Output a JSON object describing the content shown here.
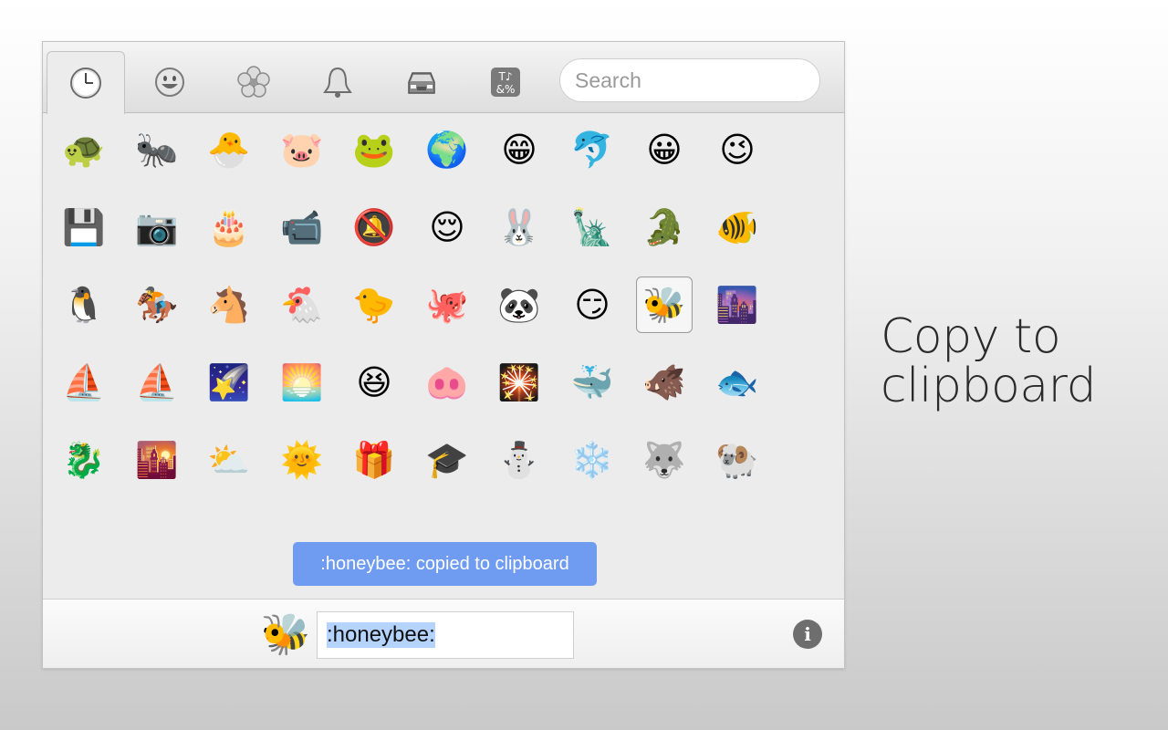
{
  "tabs": [
    {
      "name": "recent",
      "icon": "clock-icon"
    },
    {
      "name": "people",
      "icon": "smiley-icon"
    },
    {
      "name": "nature",
      "icon": "flower-icon"
    },
    {
      "name": "objects",
      "icon": "bell-icon"
    },
    {
      "name": "places",
      "icon": "car-icon"
    },
    {
      "name": "symbols",
      "icon": "symbols-icon",
      "glyph_top": "T♪",
      "glyph_bottom": "&%"
    }
  ],
  "active_tab": "recent",
  "search": {
    "placeholder": "Search",
    "value": ""
  },
  "emoji_grid": [
    [
      "🐢",
      "🐜",
      "🐣",
      "🐷",
      "🐸",
      "🌍",
      "😁",
      "🐬",
      "😀",
      "😉"
    ],
    [
      "💾",
      "📷",
      "🎂",
      "📹",
      "🔕",
      "😌",
      "🐰",
      "🗽",
      "🐊",
      "🐠"
    ],
    [
      "🐧",
      "🏇",
      "🐴",
      "🐔",
      "🐤",
      "🐙",
      "🐼",
      "😏",
      "🐝",
      "🌆"
    ],
    [
      "⛵",
      "⛵",
      "🌠",
      "🌅",
      "😆",
      "🐽",
      "🎇",
      "🐳",
      "🐗",
      "🐟"
    ],
    [
      "🐉",
      "🌇",
      "⛅",
      "🌞",
      "🎁",
      "🎓",
      "⛄",
      "❄️",
      "🐺",
      "🐏"
    ]
  ],
  "selected_emoji": {
    "row": 2,
    "col": 8
  },
  "toast": {
    "text": ":honeybee: copied to clipboard"
  },
  "footer": {
    "preview_emoji": "🐝",
    "code_value": ":honeybee:",
    "info_icon": "info-icon",
    "info_glyph": "i"
  },
  "caption": {
    "line1": "Copy to",
    "line2": "clipboard"
  },
  "colors": {
    "toast_bg": "#6f9cf0",
    "selection_highlight": "#b4d4ff"
  }
}
